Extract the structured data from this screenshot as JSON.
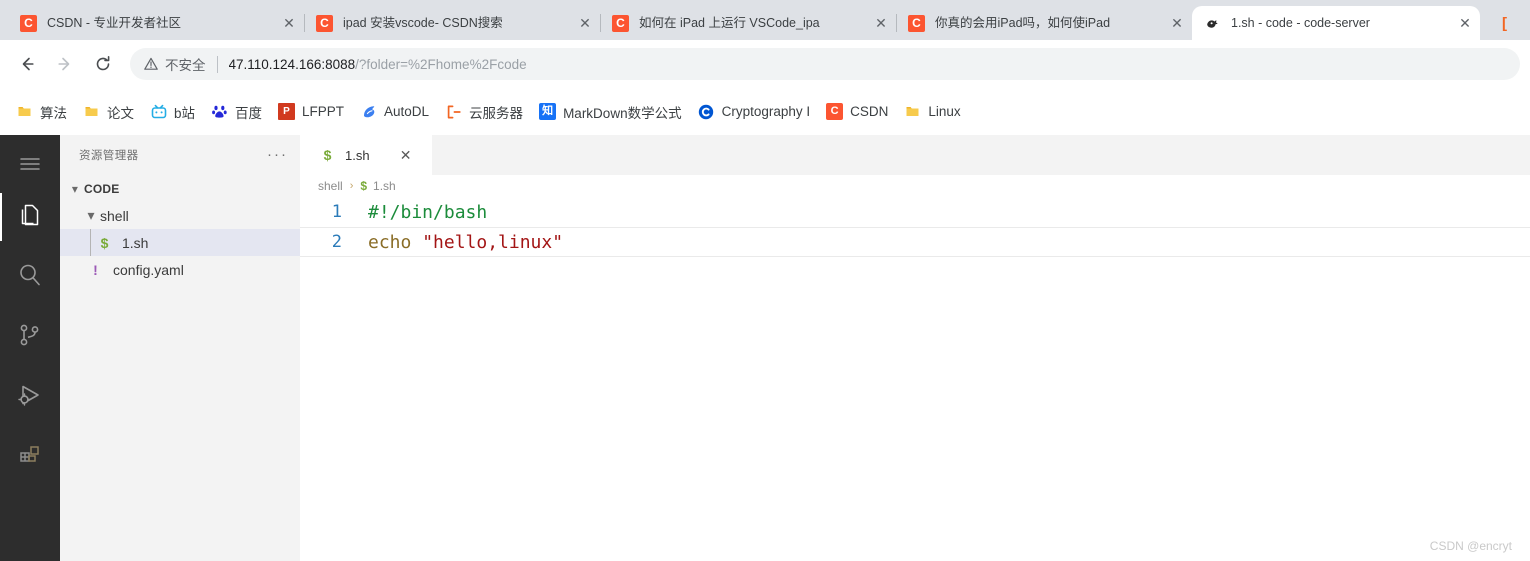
{
  "browser": {
    "tabs": [
      {
        "title": "CSDN - 专业开发者社区",
        "icon": "csdn-icon",
        "active": false
      },
      {
        "title": "ipad 安装vscode- CSDN搜索",
        "icon": "csdn-icon",
        "active": false
      },
      {
        "title": "如何在 iPad 上运行 VSCode_ipa",
        "icon": "csdn-icon",
        "active": false
      },
      {
        "title": "你真的会用iPad吗，如何使iPad",
        "icon": "csdn-icon",
        "active": false
      },
      {
        "title": "1.sh - code - code-server",
        "icon": "code-server-icon",
        "active": true
      }
    ],
    "tab_close_label": "✕",
    "nav": {
      "back": "←",
      "forward": "→",
      "reload": "⟳"
    },
    "omnibox": {
      "security_label": "不安全",
      "warning_icon": "warning-triangle-icon",
      "url_host": "47.110.124.166:8088",
      "url_path": "/?folder=%2Fhome%2Fcode"
    },
    "bookmarks": [
      {
        "label": "算法",
        "icon": "folder-icon"
      },
      {
        "label": "论文",
        "icon": "folder-icon"
      },
      {
        "label": "b站",
        "icon": "bilibili-icon"
      },
      {
        "label": "百度",
        "icon": "baidu-icon"
      },
      {
        "label": "LFPPT",
        "icon": "powerpoint-icon",
        "icon_text": "P"
      },
      {
        "label": "AutoDL",
        "icon": "autodl-icon"
      },
      {
        "label": "云服务器",
        "icon": "bracket-icon",
        "icon_text": "[-]"
      },
      {
        "label": "MarkDown数学公式",
        "icon": "zhihu-icon",
        "icon_text": "知"
      },
      {
        "label": "Cryptography I",
        "icon": "coursera-icon",
        "icon_text": "C"
      },
      {
        "label": "CSDN",
        "icon": "csdn-icon",
        "icon_text": "C"
      },
      {
        "label": "Linux",
        "icon": "folder-icon"
      }
    ]
  },
  "vscode": {
    "activitybar": [
      {
        "name": "menu",
        "icon": "hamburger-menu-icon",
        "active": false
      },
      {
        "name": "explorer",
        "icon": "files-icon",
        "active": true
      },
      {
        "name": "search",
        "icon": "search-icon",
        "active": false
      },
      {
        "name": "source-control",
        "icon": "source-control-icon",
        "active": false
      },
      {
        "name": "run-and-debug",
        "icon": "run-debug-icon",
        "active": false
      },
      {
        "name": "extensions",
        "icon": "extensions-icon",
        "active": false
      }
    ],
    "sidebar": {
      "title": "资源管理器",
      "more_actions": "···",
      "tree": [
        {
          "label": "CODE",
          "type": "section",
          "expanded": true,
          "chevron": "▾",
          "indent": 0
        },
        {
          "label": "shell",
          "type": "folder",
          "expanded": true,
          "chevron": "▾",
          "indent": 1
        },
        {
          "label": "1.sh",
          "type": "file",
          "icon_char": "$",
          "icon_kind": "sh",
          "indent": 2,
          "selected": true
        },
        {
          "label": "config.yaml",
          "type": "file",
          "icon_char": "!",
          "icon_kind": "yaml",
          "indent": 1,
          "selected": false
        }
      ]
    },
    "editor": {
      "tab": {
        "label": "1.sh",
        "icon_char": "$",
        "close": "✕"
      },
      "breadcrumb": {
        "folder": "shell",
        "separator": "›",
        "file": "1.sh",
        "file_icon": "$"
      },
      "lines": [
        {
          "num": "1",
          "current": false,
          "tokens": [
            {
              "text": "#!/bin/bash",
              "cls": "tok-comment"
            }
          ]
        },
        {
          "num": "2",
          "current": true,
          "tokens": [
            {
              "text": "echo ",
              "cls": "tok-fn"
            },
            {
              "text": "\"hello,linux\"",
              "cls": "tok-str"
            }
          ]
        }
      ]
    },
    "watermark": "CSDN @encryt"
  }
}
